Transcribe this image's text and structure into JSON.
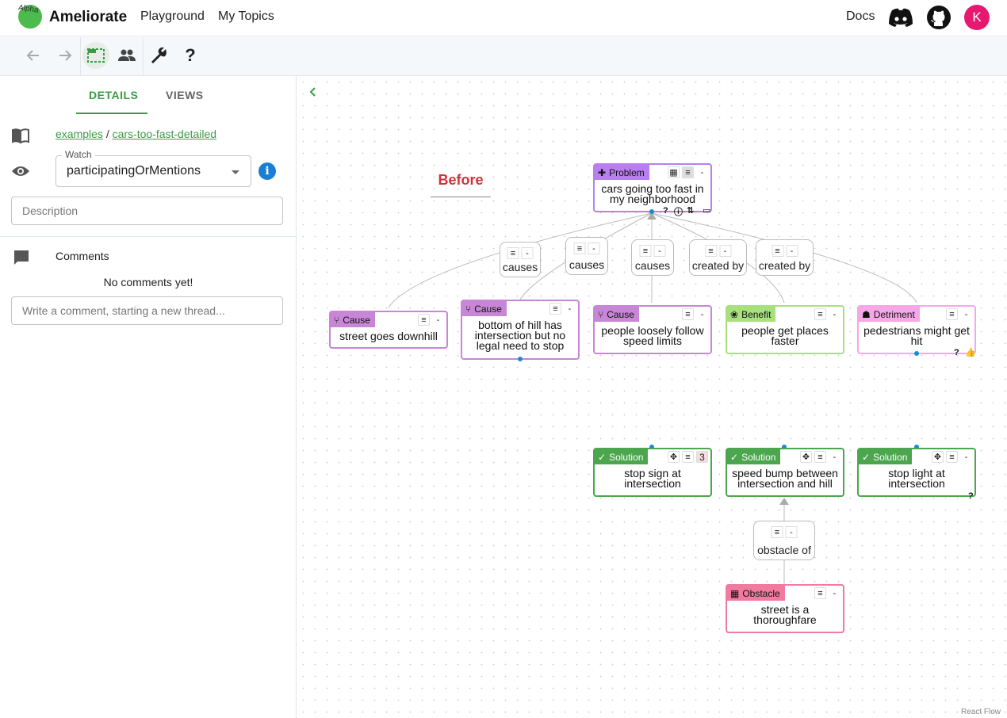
{
  "topbar": {
    "alpha": "Alpha",
    "brand": "Ameliorate",
    "nav": [
      "Playground",
      "My Topics"
    ],
    "docs": "Docs",
    "avatar_letter": "K"
  },
  "sidebar": {
    "tabs": [
      "DETAILS",
      "VIEWS"
    ],
    "breadcrumb_parent": "examples",
    "breadcrumb_sep": "/",
    "breadcrumb_topic": "cars-too-fast-detailed",
    "watch_label": "Watch",
    "watch_value": "participatingOrMentions",
    "description_placeholder": "Description",
    "comments_title": "Comments",
    "no_comments": "No comments yet!",
    "comment_placeholder": "Write a comment, starting a new thread..."
  },
  "canvas": {
    "before_label": "Before",
    "react_flow": "React Flow",
    "nodes": {
      "problem": {
        "tag": "Problem",
        "text": "cars going too fast in my neighborhood"
      },
      "cause1": {
        "tag": "Cause",
        "text": "street goes downhill"
      },
      "cause2": {
        "tag": "Cause",
        "text": "bottom of hill has intersection but no legal need to stop"
      },
      "cause3": {
        "tag": "Cause",
        "text": "people loosely follow speed limits"
      },
      "benefit": {
        "tag": "Benefit",
        "text": "people get places faster"
      },
      "detriment": {
        "tag": "Detriment",
        "text": "pedestrians might get hit"
      },
      "solution1": {
        "tag": "Solution",
        "text": "stop sign at intersection",
        "count": "3"
      },
      "solution2": {
        "tag": "Solution",
        "text": "speed bump between intersection and hill"
      },
      "solution3": {
        "tag": "Solution",
        "text": "stop light at intersection"
      },
      "obstacle": {
        "tag": "Obstacle",
        "text": "street is a thoroughfare"
      }
    },
    "edges": {
      "e1": "causes",
      "e2": "causes",
      "e3": "causes",
      "e4": "created by",
      "e5": "created by",
      "e6": "obstacle of"
    },
    "btn_minus": "-",
    "btn_question": "?"
  },
  "colors": {
    "primary": "#3a9b47",
    "problem": "#b97ef0",
    "cause": "#c887d6",
    "benefit": "#a9e07e",
    "detriment": "#f6a7e8",
    "solution": "#4ca64e",
    "obstacle": "#f07aa0",
    "avatar": "#e6186f"
  }
}
